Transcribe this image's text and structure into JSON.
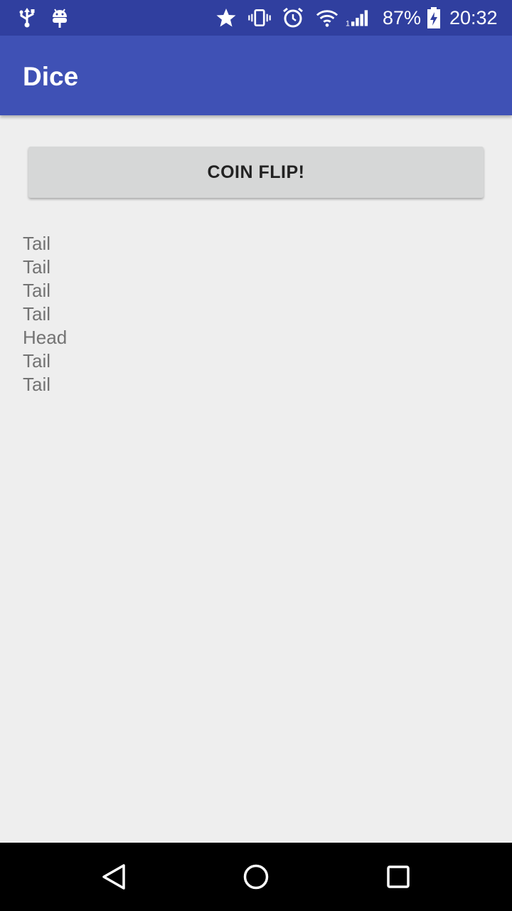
{
  "status_bar": {
    "left_icons": [
      "usb-icon",
      "android-debug-icon"
    ],
    "right_icons": [
      "star-icon",
      "vibrate-icon",
      "alarm-icon",
      "wifi-icon",
      "signal-icon",
      "battery-charging-icon"
    ],
    "battery": "87%",
    "time": "20:32",
    "background": "#303f9f"
  },
  "app_bar": {
    "title": "Dice",
    "background": "#3f51b5"
  },
  "main": {
    "flip_button_label": "COIN FLIP!",
    "results": [
      "Tail",
      "Tail",
      "Tail",
      "Tail",
      "Head",
      "Tail",
      "Tail"
    ]
  },
  "nav_bar": {
    "buttons": [
      "back-icon",
      "home-icon",
      "recents-icon"
    ]
  }
}
